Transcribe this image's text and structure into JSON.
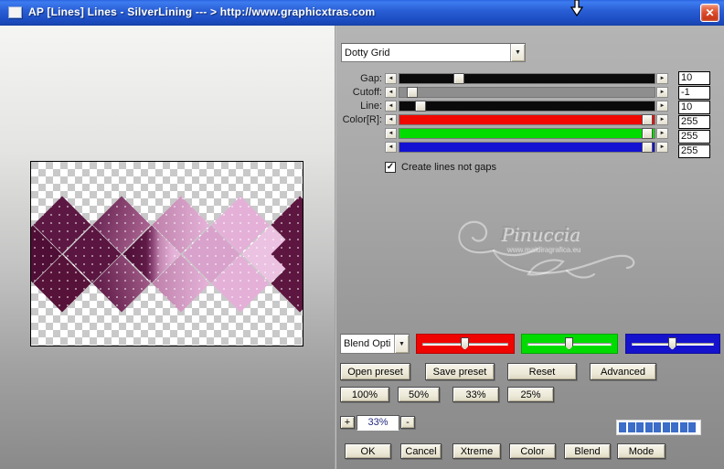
{
  "window": {
    "title": "AP [Lines]  Lines - SilverLining    --- > http://www.graphicxtras.com",
    "close_glyph": "✕"
  },
  "controls": {
    "pattern_dropdown": {
      "value": "Dotty Grid",
      "arrow": "▼"
    },
    "sliders": [
      {
        "label": "Gap:",
        "value": "10",
        "track": "#0a0a0a",
        "thumb_left": "21%"
      },
      {
        "label": "Cutoff:",
        "value": "-1",
        "track": "#8e8e8e",
        "thumb_left": "3%"
      },
      {
        "label": "Line:",
        "value": "10",
        "track": "#0a0a0a",
        "thumb_left": "6%"
      },
      {
        "label": "Color[R]:",
        "value": "255",
        "track": "#f00800",
        "thumb_left": "95%"
      },
      {
        "label": "",
        "value": "255",
        "track": "#00dc00",
        "thumb_left": "95%"
      },
      {
        "label": "",
        "value": "255",
        "track": "#1412d2",
        "thumb_left": "95%"
      }
    ],
    "arrow_left": "◄",
    "arrow_right": "►",
    "checkbox": {
      "checked_glyph": "✓",
      "label": "Create lines not gaps"
    }
  },
  "blend": {
    "dropdown": {
      "value": "Blend Opti",
      "arrow": "▼"
    },
    "channels": [
      {
        "name": "red",
        "color": "#ef0400"
      },
      {
        "name": "green",
        "color": "#00dc00"
      },
      {
        "name": "blue",
        "color": "#1412cc"
      }
    ]
  },
  "preset_buttons": [
    {
      "label": "Open preset"
    },
    {
      "label": "Save preset"
    },
    {
      "label": "Reset"
    },
    {
      "label": "Advanced"
    }
  ],
  "zoom_buttons": [
    {
      "label": "100%"
    },
    {
      "label": "50%"
    },
    {
      "label": "33%"
    },
    {
      "label": "25%"
    }
  ],
  "stepper": {
    "plus": "+",
    "value": "33%",
    "minus": "-"
  },
  "progress": {
    "blocks": 9,
    "block_color": "#3b6dc9"
  },
  "action_buttons": [
    {
      "label": "OK"
    },
    {
      "label": "Cancel"
    },
    {
      "label": "Xtreme"
    },
    {
      "label": "Color"
    },
    {
      "label": "Blend"
    },
    {
      "label": "Mode"
    }
  ],
  "watermark": {
    "name": "Pinuccia",
    "url": "www.maidiragrafica.eu"
  },
  "preview_palette": {
    "dark_maroon": "#5a1540",
    "mid_mauve": "#a8618f",
    "light_pink": "#e6b4da",
    "checker_gray": "#c9c9c9"
  }
}
